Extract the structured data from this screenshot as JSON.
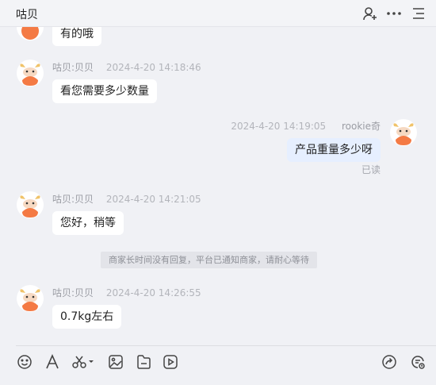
{
  "header": {
    "title": "咕贝"
  },
  "messages": [
    {
      "text": "有的哦"
    },
    {
      "sender": "咕贝:贝贝",
      "time": "2024-4-20 14:18:46",
      "text": "看您需要多少数量"
    },
    {
      "sender": "rookie奇",
      "time": "2024-4-20 14:19:05",
      "text": "产品重量多少呀",
      "status": "已读"
    },
    {
      "sender": "咕贝:贝贝",
      "time": "2024-4-20 14:21:05",
      "text": "您好，稍等"
    },
    {
      "sender": "咕贝:贝贝",
      "time": "2024-4-20 14:26:55",
      "text": "0.7kg左右"
    }
  ],
  "notice": "商家长时间没有回复，平台已通知商家，请耐心等待",
  "toolbar": {
    "icons": [
      "emoji-icon",
      "font-icon",
      "scissors-icon",
      "image-icon",
      "file-icon",
      "video-icon",
      "share-icon",
      "history-icon"
    ]
  },
  "colors": {
    "background": "#f0f1f5",
    "bubble": "#ffffff",
    "my_bubble": "#e6efff",
    "avatar": "#f47a44"
  }
}
